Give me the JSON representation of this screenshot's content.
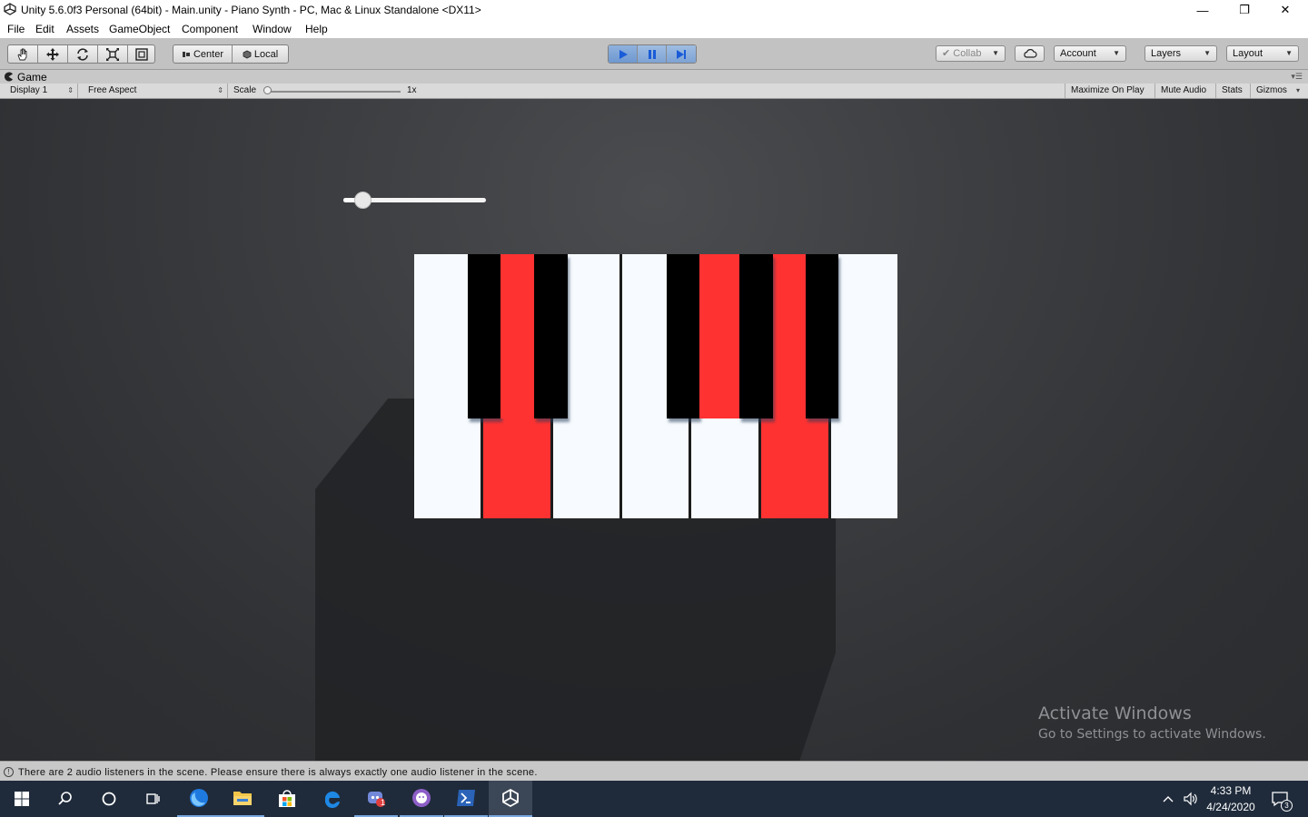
{
  "window": {
    "title": "Unity 5.6.0f3 Personal (64bit) - Main.unity - Piano Synth - PC, Mac & Linux Standalone <DX11>",
    "minimize_glyph": "—",
    "restore_glyph": "❐",
    "close_glyph": "✕"
  },
  "menu": [
    "File",
    "Edit",
    "Assets",
    "GameObject",
    "Component",
    "Window",
    "Help"
  ],
  "toolbar": {
    "pivot_center": "Center",
    "pivot_local": "Local",
    "collab": "Collab",
    "account": "Account",
    "layers": "Layers",
    "layout": "Layout"
  },
  "game_tab": {
    "label": "Game",
    "display": "Display 1",
    "aspect": "Free Aspect",
    "scale_label": "Scale",
    "scale_value": "1x",
    "maximize_on_play": "Maximize On Play",
    "mute_audio": "Mute Audio",
    "stats": "Stats",
    "gizmos": "Gizmos"
  },
  "game_view": {
    "volume_slider_value": 0.14,
    "pressed_keys": [
      "D",
      "A"
    ],
    "pressed_color": "#ff3232",
    "watermark_title": "Activate Windows",
    "watermark_subtitle": "Go to Settings to activate Windows."
  },
  "status": {
    "message": "There are 2 audio listeners in the scene. Please ensure there is always exactly one audio listener in the scene."
  },
  "taskbar": {
    "discord_badge": "1",
    "time": "4:33 PM",
    "date": "4/24/2020",
    "notification_count": "3"
  },
  "colors": {
    "play_active": "#6e98d0",
    "taskbar_bg": "#1f2b3b"
  }
}
